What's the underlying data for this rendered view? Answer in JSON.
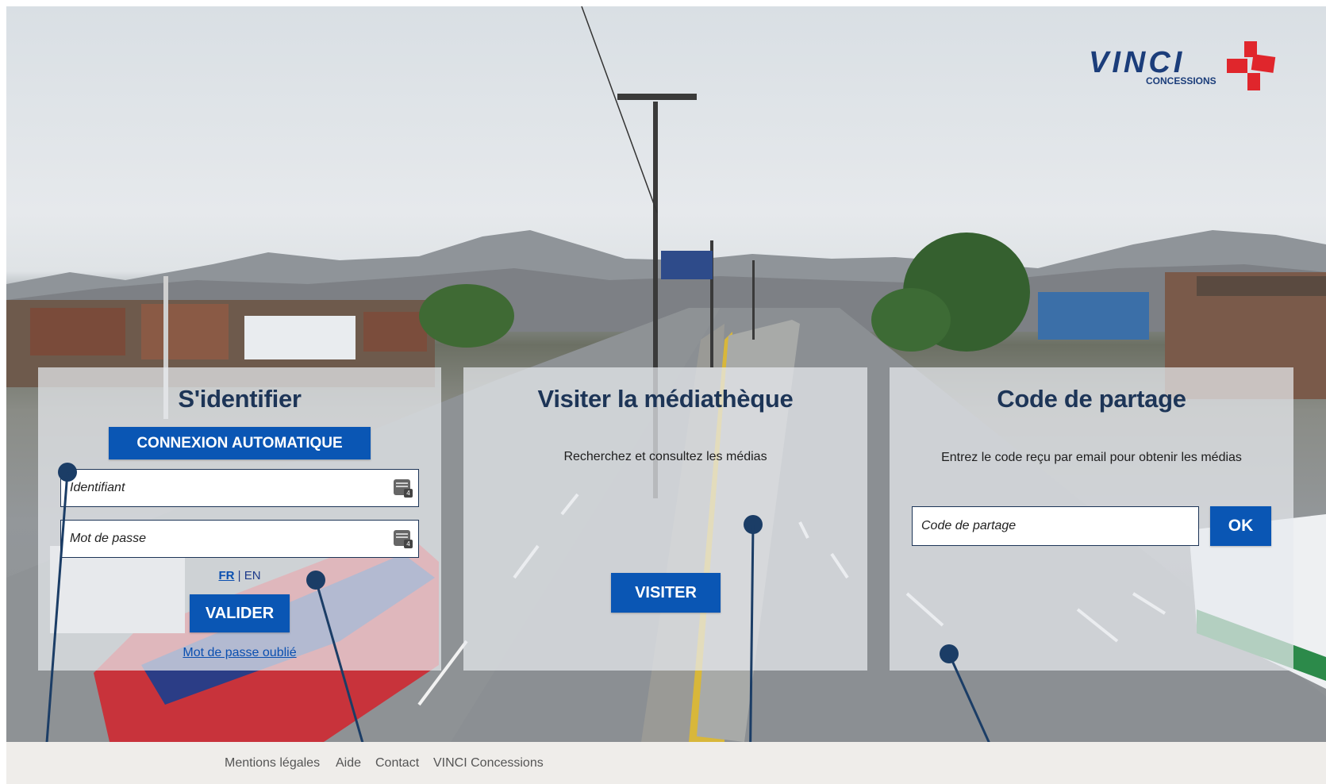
{
  "brand": {
    "name": "VINCI",
    "tagline": "CONCESSIONS",
    "colors": {
      "navy": "#1b3d7a",
      "red": "#e0262c"
    }
  },
  "login": {
    "title": "S'identifier",
    "auto_login_label": "CONNEXION AUTOMATIQUE",
    "username_placeholder": "Identifiant",
    "password_placeholder": "Mot de passe",
    "lang_fr": "FR",
    "lang_sep": "|",
    "lang_en": "EN",
    "submit_label": "VALIDER",
    "forgot_password": "Mot de passe oublié"
  },
  "media": {
    "title": "Visiter la médiathèque",
    "description": "Recherchez et consultez les médias",
    "visit_label": "VISITER"
  },
  "share": {
    "title": "Code de partage",
    "description": "Entrez le code reçu par email pour obtenir les médias",
    "code_placeholder": "Code de partage",
    "ok_label": "OK"
  },
  "footer": {
    "links": [
      "Mentions légales",
      "Aide",
      "Contact",
      "VINCI Concessions"
    ]
  },
  "accent_color": "#0a56b4",
  "title_color": "#1d3557"
}
